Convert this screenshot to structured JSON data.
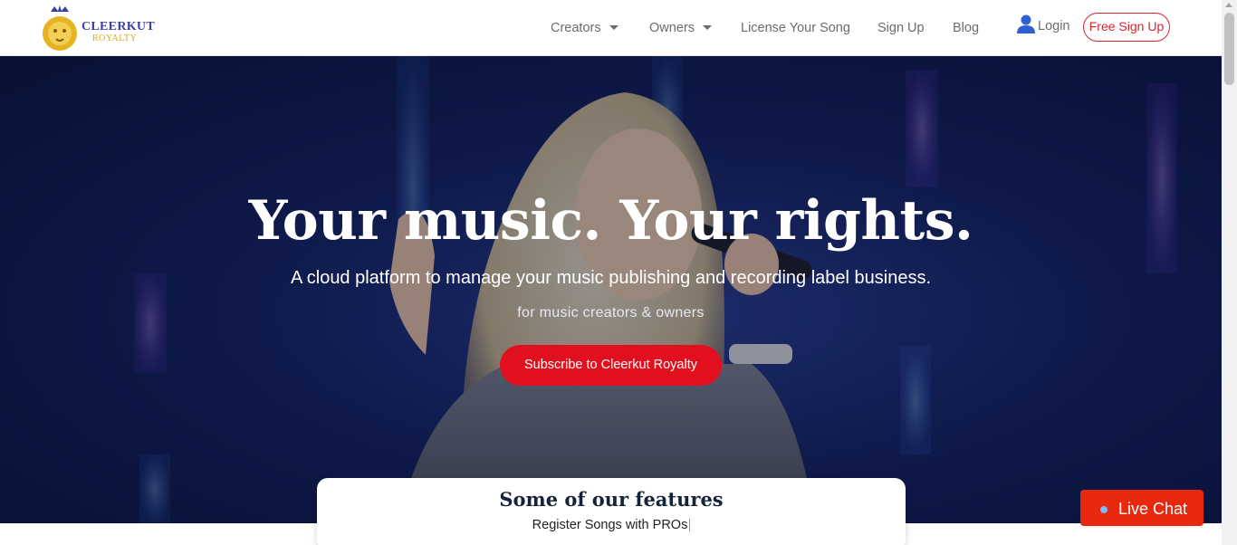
{
  "brand": {
    "name": "CLEERKUT",
    "sub": "ROYALTY",
    "logo_icon": "lion-crown-icon",
    "primary_color": "#e2101f",
    "link_color": "#e0212e",
    "accent_color": "#3a3fa8"
  },
  "nav": {
    "items": [
      {
        "label": "Creators",
        "dropdown": true
      },
      {
        "label": "Owners",
        "dropdown": true
      },
      {
        "label": "License Your Song",
        "dropdown": false
      },
      {
        "label": "Sign Up",
        "dropdown": false
      },
      {
        "label": "Blog",
        "dropdown": false
      }
    ],
    "login_label": "Login",
    "login_icon": "user-icon",
    "signup_label": "Free Sign Up"
  },
  "hero": {
    "title": "Your music. Your rights.",
    "subtitle": "A cloud platform to manage your music publishing and recording label business.",
    "tagline": "for music creators & owners",
    "cta_label": "Subscribe to Cleerkut Royalty",
    "background": "singer-performing-with-microphone-photo"
  },
  "features": {
    "title": "Some of our features",
    "current_item": "Register Songs with PROs"
  },
  "chat": {
    "label": "Live Chat",
    "icon": "chat-status-dot-icon",
    "color": "#e7290f"
  }
}
